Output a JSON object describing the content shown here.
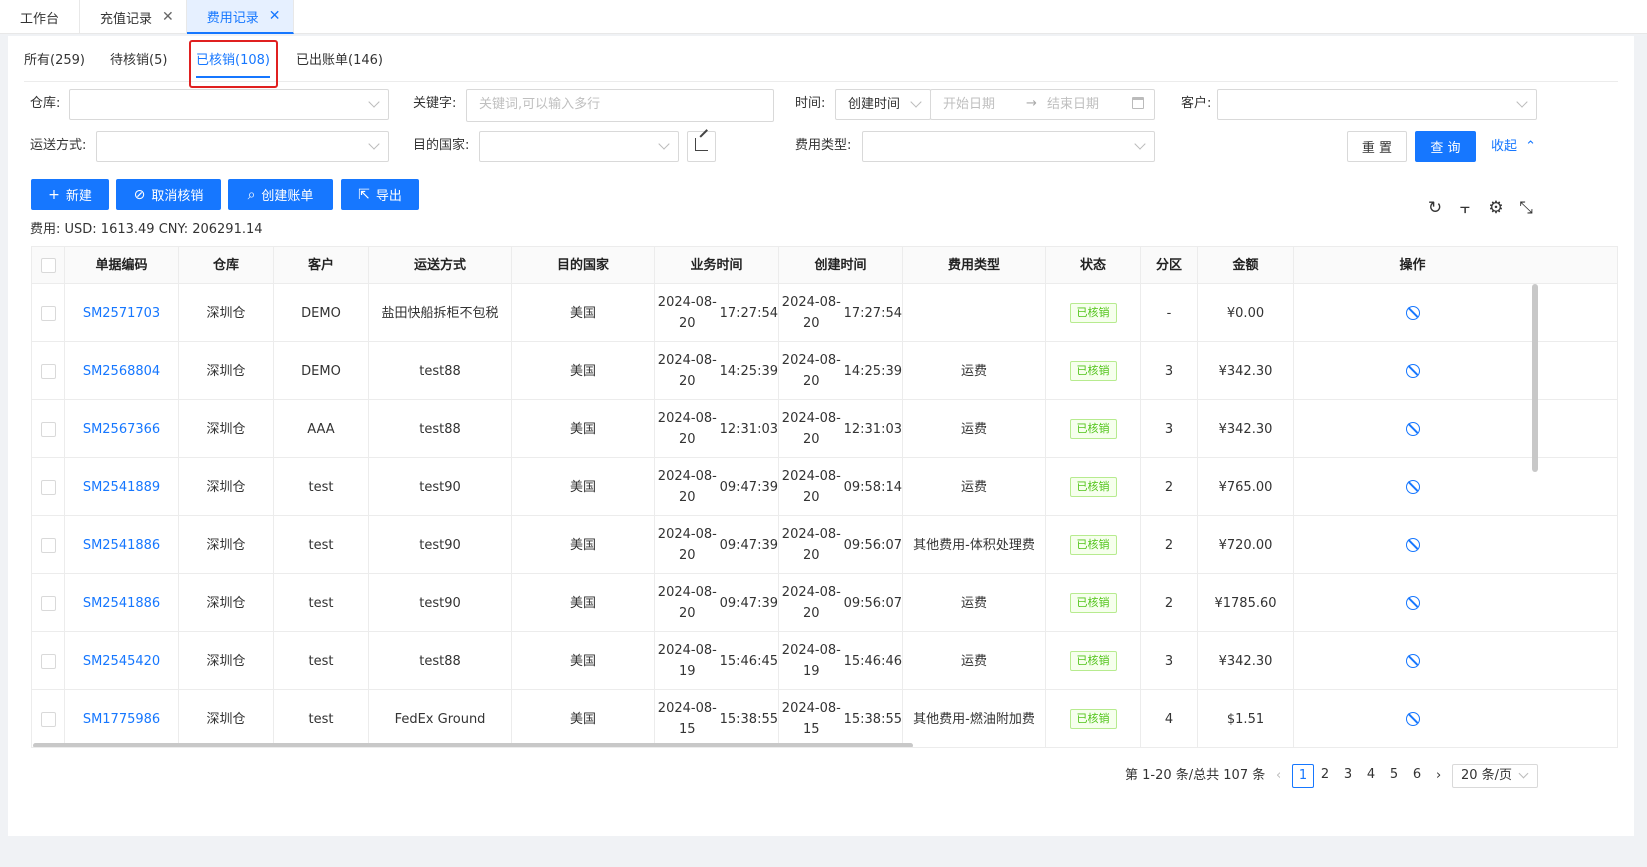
{
  "page_tabs": [
    {
      "label": "工作台",
      "closable": false
    },
    {
      "label": "充值记录",
      "closable": true
    },
    {
      "label": "费用记录",
      "closable": true,
      "active": true
    }
  ],
  "status_tabs": [
    {
      "label": "所有(259)"
    },
    {
      "label": "待核销(5)"
    },
    {
      "label": "已核销(108)",
      "active": true
    },
    {
      "label": "已出账单(146)"
    }
  ],
  "filters": {
    "warehouse_label": "仓库:",
    "keyword_label": "关键字:",
    "keyword_placeholder": "关键词,可以输入多行",
    "time_label": "时间:",
    "time_type_value": "创建时间",
    "start_date_placeholder": "开始日期",
    "end_date_placeholder": "结束日期",
    "customer_label": "客户:",
    "shipping_label": "运送方式:",
    "country_label": "目的国家:",
    "fee_type_label": "费用类型:",
    "reset_label": "重 置",
    "query_label": "查 询",
    "collapse_label": "收起"
  },
  "actions": {
    "new_label": "新建",
    "cancel_verify_label": "取消核销",
    "create_bill_label": "创建账单",
    "export_label": "导出"
  },
  "fee_summary": "费用: USD: 1613.49 CNY: 206291.14",
  "table": {
    "columns": [
      "单据编码",
      "仓库",
      "客户",
      "运送方式",
      "目的国家",
      "业务时间",
      "创建时间",
      "费用类型",
      "状态",
      "分区",
      "金额",
      "操作"
    ],
    "rows": [
      {
        "code": "SM2571703",
        "warehouse": "深圳仓",
        "customer": "DEMO",
        "shipping": "盐田快船拆柜不包税",
        "country": "美国",
        "biz_date": "2024-08-20",
        "biz_time": "17:27:54",
        "create_date": "2024-08-20",
        "create_time": "17:27:54",
        "fee_type": "",
        "status": "已核销",
        "zone": "-",
        "amount": "¥0.00"
      },
      {
        "code": "SM2568804",
        "warehouse": "深圳仓",
        "customer": "DEMO",
        "shipping": "test88",
        "country": "美国",
        "biz_date": "2024-08-20",
        "biz_time": "14:25:39",
        "create_date": "2024-08-20",
        "create_time": "14:25:39",
        "fee_type": "运费",
        "status": "已核销",
        "zone": "3",
        "amount": "¥342.30"
      },
      {
        "code": "SM2567366",
        "warehouse": "深圳仓",
        "customer": "AAA",
        "shipping": "test88",
        "country": "美国",
        "biz_date": "2024-08-20",
        "biz_time": "12:31:03",
        "create_date": "2024-08-20",
        "create_time": "12:31:03",
        "fee_type": "运费",
        "status": "已核销",
        "zone": "3",
        "amount": "¥342.30"
      },
      {
        "code": "SM2541889",
        "warehouse": "深圳仓",
        "customer": "test",
        "shipping": "test90",
        "country": "美国",
        "biz_date": "2024-08-20",
        "biz_time": "09:47:39",
        "create_date": "2024-08-20",
        "create_time": "09:58:14",
        "fee_type": "运费",
        "status": "已核销",
        "zone": "2",
        "amount": "¥765.00"
      },
      {
        "code": "SM2541886",
        "warehouse": "深圳仓",
        "customer": "test",
        "shipping": "test90",
        "country": "美国",
        "biz_date": "2024-08-20",
        "biz_time": "09:47:39",
        "create_date": "2024-08-20",
        "create_time": "09:56:07",
        "fee_type": "其他费用-体积处理费",
        "status": "已核销",
        "zone": "2",
        "amount": "¥720.00"
      },
      {
        "code": "SM2541886",
        "warehouse": "深圳仓",
        "customer": "test",
        "shipping": "test90",
        "country": "美国",
        "biz_date": "2024-08-20",
        "biz_time": "09:47:39",
        "create_date": "2024-08-20",
        "create_time": "09:56:07",
        "fee_type": "运费",
        "status": "已核销",
        "zone": "2",
        "amount": "¥1785.60"
      },
      {
        "code": "SM2545420",
        "warehouse": "深圳仓",
        "customer": "test",
        "shipping": "test88",
        "country": "美国",
        "biz_date": "2024-08-19",
        "biz_time": "15:46:45",
        "create_date": "2024-08-19",
        "create_time": "15:46:46",
        "fee_type": "运费",
        "status": "已核销",
        "zone": "3",
        "amount": "¥342.30"
      },
      {
        "code": "SM1775986",
        "warehouse": "深圳仓",
        "customer": "test",
        "shipping": "FedEx Ground",
        "country": "美国",
        "biz_date": "2024-08-15",
        "biz_time": "15:38:55",
        "create_date": "2024-08-15",
        "create_time": "15:38:55",
        "fee_type": "其他费用-燃油附加费",
        "status": "已核销",
        "zone": "4",
        "amount": "$1.51"
      }
    ]
  },
  "pagination": {
    "summary": "第 1-20 条/总共 107 条",
    "pages": [
      "1",
      "2",
      "3",
      "4",
      "5",
      "6"
    ],
    "current": "1",
    "page_size": "20 条/页"
  },
  "colors": {
    "primary": "#1677ff",
    "success": "#52c41a",
    "highlight": "#e02020"
  }
}
